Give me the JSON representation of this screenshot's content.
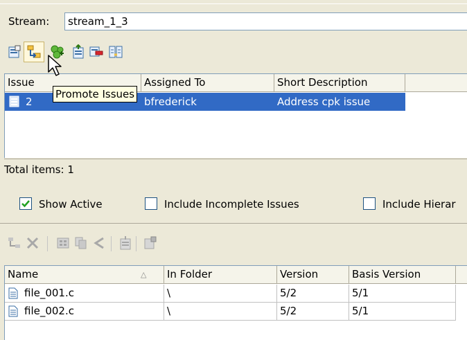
{
  "stream": {
    "label": "Stream:",
    "value": "stream_1_3"
  },
  "toolbar": {
    "icons": [
      "issue-properties-icon",
      "promote-issues-icon",
      "add-issues-icon",
      "send-to-issue-icon",
      "remove-icon",
      "compare-icon"
    ]
  },
  "tooltip": {
    "text": "Promote Issues"
  },
  "issues": {
    "columns": [
      "Issue",
      "Assigned To",
      "Short Description"
    ],
    "rows": [
      {
        "issue": "2",
        "assigned_to": "bfrederick",
        "short_description": "Address cpk issue"
      }
    ],
    "total": "Total items: 1"
  },
  "filters": {
    "show_active": {
      "label": "Show Active",
      "checked": true
    },
    "include_incomplete": {
      "label": "Include Incomplete Issues",
      "checked": false
    },
    "include_hierarchy": {
      "label": "Include Hierar",
      "checked": false
    }
  },
  "files": {
    "columns": [
      "Name",
      "In Folder",
      "Version",
      "Basis Version"
    ],
    "sort_indicator": "△",
    "rows": [
      {
        "name": "file_001.c",
        "folder": "\\",
        "version": "5/2",
        "basis": "5/1"
      },
      {
        "name": "file_002.c",
        "folder": "\\",
        "version": "5/2",
        "basis": "5/1"
      }
    ]
  },
  "colors": {
    "selection": "#316ac5",
    "background": "#ece9d8",
    "tooltip": "#ffffe1"
  }
}
